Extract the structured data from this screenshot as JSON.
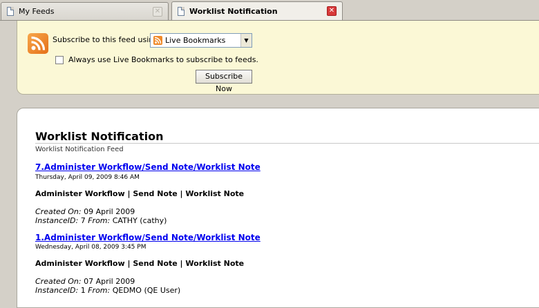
{
  "tabs": [
    {
      "label": "My Feeds",
      "active": false
    },
    {
      "label": "Worklist Notification",
      "active": true
    }
  ],
  "subscribe": {
    "label": "Subscribe to this feed using",
    "reader": "Live Bookmarks",
    "always_label": "Always use Live Bookmarks to subscribe to feeds.",
    "always_checked": false,
    "button_label": "Subscribe Now"
  },
  "feed": {
    "title": "Worklist Notification",
    "subtitle": "Worklist Notification Feed",
    "entries": [
      {
        "title": "7.Administer Workflow/Send Note/Worklist Note",
        "date": "Thursday, April 09, 2009 8:46 AM",
        "summary": "Administer Workflow | Send Note | Worklist Note",
        "created_label": "Created On:",
        "created_value": " 09 April 2009",
        "instance_label": "InstanceID:",
        "instance_value": " 7 ",
        "from_label": "From:",
        "from_value": " CATHY (cathy)"
      },
      {
        "title": "1.Administer Workflow/Send Note/Worklist Note",
        "date": "Wednesday, April 08, 2009 3:45 PM",
        "summary": "Administer Workflow | Send Note | Worklist Note",
        "created_label": "Created On:",
        "created_value": " 07 April 2009",
        "instance_label": "InstanceID:",
        "instance_value": " 1 ",
        "from_label": "From:",
        "from_value": " QEDMO (QE User)"
      }
    ]
  },
  "icons": {
    "tab_page": "document-icon",
    "tab_close": "close-icon",
    "feed": "rss-feed-icon",
    "dropdown": "chevron-down-icon"
  },
  "colors": {
    "link": "#0000ee",
    "subscribe_bg": "#fbf8d6",
    "chrome": "#d4d0c8",
    "close_active": "#d83a3a"
  }
}
